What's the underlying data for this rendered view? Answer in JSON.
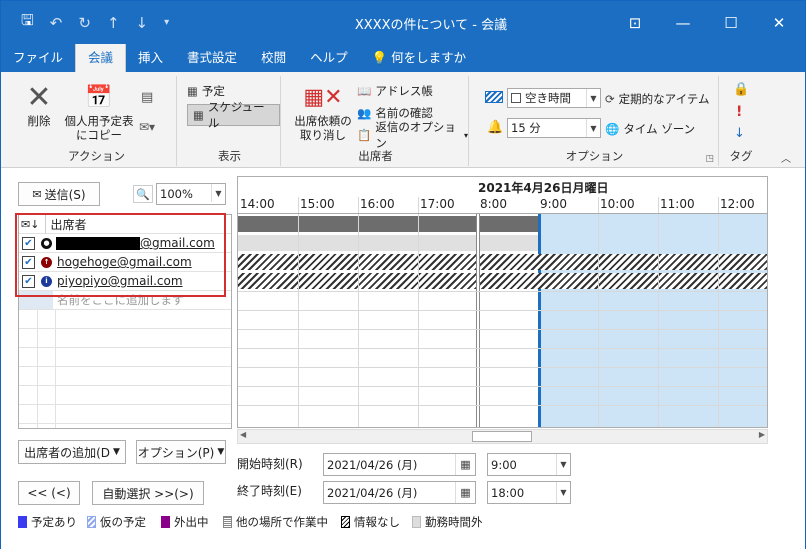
{
  "window": {
    "title": "XXXXの件について  -  会議"
  },
  "menu": {
    "tabs": [
      "ファイル",
      "会議",
      "挿入",
      "書式設定",
      "校閲",
      "ヘルプ",
      "何をしますか"
    ],
    "active_index": 1
  },
  "ribbon": {
    "action": {
      "label": "アクション",
      "delete": "削除",
      "copy_to_calendar": "個人用予定表にコピー"
    },
    "display": {
      "label": "表示",
      "appointment": "予定",
      "schedule": "スケジュール"
    },
    "attendees": {
      "label": "出席者",
      "cancel_request": "出席依頼の取り消し",
      "address_book": "アドレス帳",
      "check_names": "名前の確認",
      "response_options": "返信のオプション"
    },
    "options": {
      "label": "オプション",
      "show_as": "空き時間",
      "reminder": "15 分",
      "recurrence": "定期的なアイテム",
      "time_zone": "タイム ゾーン"
    },
    "tags": {
      "label": "タグ"
    }
  },
  "toolbar": {
    "send": "送信(S)",
    "zoom": "100%"
  },
  "attendees": {
    "header": "出席者",
    "list": [
      {
        "email": "@gmail.com",
        "role": "organizer",
        "redacted": true
      },
      {
        "email": "hogehoge@gmail.com",
        "role": "required"
      },
      {
        "email": "piyopiyo@gmail.com",
        "role": "optional"
      }
    ],
    "add_placeholder": "名前をここに追加します"
  },
  "schedule": {
    "date": "2021年4月26日月曜日",
    "hours": [
      "14:00",
      "15:00",
      "16:00",
      "17:00",
      "8:00",
      "9:00",
      "10:00",
      "11:00",
      "12:00"
    ]
  },
  "bottom": {
    "add_attendees": "出席者の追加(D",
    "options": "オプション(P)",
    "prev": "<< (<)",
    "autopick": "自動選択 >>(>)",
    "start_label": "開始時刻(R)",
    "end_label": "終了時刻(E)",
    "start_date": "2021/04/26 (月)",
    "start_time": "9:00",
    "end_date": "2021/04/26 (月)",
    "end_time": "18:00"
  },
  "legend": [
    {
      "label": "予定あり",
      "color": "#3a3af0"
    },
    {
      "label": "仮の予定",
      "color": "#8fa8f0"
    },
    {
      "label": "外出中",
      "color": "#8b008b"
    },
    {
      "label": "他の場所で作業中",
      "color": "#888888"
    },
    {
      "label": "情報なし",
      "color": "#000000"
    },
    {
      "label": "勤務時間外",
      "color": "#dddddd"
    }
  ]
}
